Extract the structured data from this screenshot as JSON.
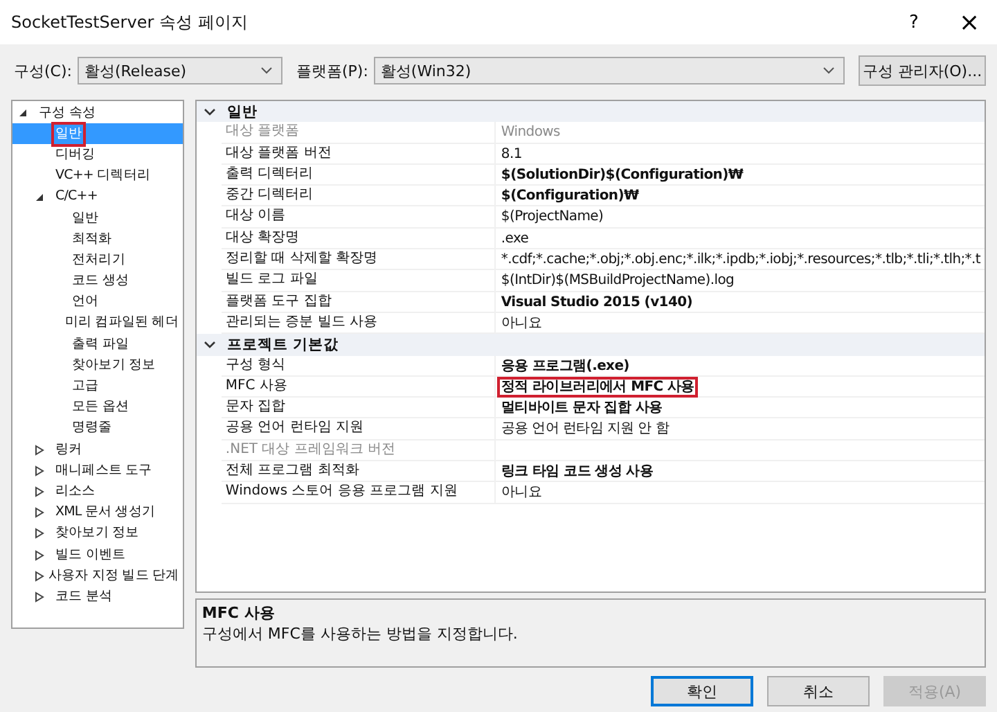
{
  "window": {
    "title": "SocketTestServer 속성 페이지",
    "help": "?",
    "close": "×"
  },
  "config_bar": {
    "configuration_label": "구성(C):",
    "configuration_value": "활성(Release)",
    "platform_label": "플랫폼(P):",
    "platform_value": "활성(Win32)",
    "manager_button": "구성 관리자(O)..."
  },
  "tree": {
    "items": [
      {
        "label": "구성 속성",
        "expanded": true,
        "selected": false,
        "annotated": false,
        "children": [
          {
            "label": "일반",
            "selected": true,
            "annotated": true
          },
          {
            "label": "디버깅",
            "selected": false,
            "annotated": false
          },
          {
            "label": "VC++ 디렉터리",
            "selected": false,
            "annotated": false
          },
          {
            "label": "C/C++",
            "expanded": true,
            "selected": false,
            "annotated": false,
            "children": [
              {
                "label": "일반",
                "selected": false,
                "annotated": false
              },
              {
                "label": "최적화",
                "selected": false,
                "annotated": false
              },
              {
                "label": "전처리기",
                "selected": false,
                "annotated": false
              },
              {
                "label": "코드 생성",
                "selected": false,
                "annotated": false
              },
              {
                "label": "언어",
                "selected": false,
                "annotated": false
              },
              {
                "label": "미리 컴파일된 헤더",
                "selected": false,
                "annotated": false
              },
              {
                "label": "출력 파일",
                "selected": false,
                "annotated": false
              },
              {
                "label": "찾아보기 정보",
                "selected": false,
                "annotated": false
              },
              {
                "label": "고급",
                "selected": false,
                "annotated": false
              },
              {
                "label": "모든 옵션",
                "selected": false,
                "annotated": false
              },
              {
                "label": "명령줄",
                "selected": false,
                "annotated": false
              }
            ]
          },
          {
            "label": "링커",
            "expanded": false,
            "selected": false,
            "annotated": false
          },
          {
            "label": "매니페스트 도구",
            "expanded": false,
            "selected": false,
            "annotated": false
          },
          {
            "label": "리소스",
            "expanded": false,
            "selected": false,
            "annotated": false
          },
          {
            "label": "XML 문서 생성기",
            "expanded": false,
            "selected": false,
            "annotated": false
          },
          {
            "label": "찾아보기 정보",
            "expanded": false,
            "selected": false,
            "annotated": false
          },
          {
            "label": "빌드 이벤트",
            "expanded": false,
            "selected": false,
            "annotated": false
          },
          {
            "label": "사용자 지정 빌드 단계",
            "expanded": false,
            "selected": false,
            "annotated": false
          },
          {
            "label": "코드 분석",
            "expanded": false,
            "selected": false,
            "annotated": false
          }
        ]
      }
    ]
  },
  "property_grid": {
    "sections": [
      {
        "title": "일반",
        "expanded": true,
        "rows": [
          {
            "label": "대상 플랫폼",
            "value": "Windows",
            "bold": false,
            "disabled": true,
            "annotated": false
          },
          {
            "label": "대상 플랫폼 버전",
            "value": "8.1",
            "bold": false,
            "disabled": false,
            "annotated": false
          },
          {
            "label": "출력 디렉터리",
            "value": "$(SolutionDir)$(Configuration)₩",
            "bold": true,
            "disabled": false,
            "annotated": false
          },
          {
            "label": "중간 디렉터리",
            "value": "$(Configuration)₩",
            "bold": true,
            "disabled": false,
            "annotated": false
          },
          {
            "label": "대상 이름",
            "value": "$(ProjectName)",
            "bold": false,
            "disabled": false,
            "annotated": false
          },
          {
            "label": "대상 확장명",
            "value": ".exe",
            "bold": false,
            "disabled": false,
            "annotated": false
          },
          {
            "label": "정리할 때 삭제할 확장명",
            "value": "*.cdf;*.cache;*.obj;*.obj.enc;*.ilk;*.ipdb;*.iobj;*.resources;*.tlb;*.tli;*.tlh;*.t",
            "bold": false,
            "disabled": false,
            "annotated": false
          },
          {
            "label": "빌드 로그 파일",
            "value": "$(IntDir)$(MSBuildProjectName).log",
            "bold": false,
            "disabled": false,
            "annotated": false
          },
          {
            "label": "플랫폼 도구 집합",
            "value": "Visual Studio 2015 (v140)",
            "bold": true,
            "disabled": false,
            "annotated": false
          },
          {
            "label": "관리되는 증분 빌드 사용",
            "value": "아니요",
            "bold": false,
            "disabled": false,
            "annotated": false
          }
        ]
      },
      {
        "title": "프로젝트 기본값",
        "expanded": true,
        "rows": [
          {
            "label": "구성 형식",
            "value": "응용 프로그램(.exe)",
            "bold": true,
            "disabled": false,
            "annotated": false
          },
          {
            "label": "MFC 사용",
            "value": "정적 라이브러리에서 MFC 사용",
            "bold": true,
            "disabled": false,
            "annotated": true
          },
          {
            "label": "문자 집합",
            "value": "멀티바이트 문자 집합 사용",
            "bold": true,
            "disabled": false,
            "annotated": false
          },
          {
            "label": "공용 언어 런타임 지원",
            "value": "공용 언어 런타임 지원 안 함",
            "bold": false,
            "disabled": false,
            "annotated": false
          },
          {
            "label": ".NET 대상 프레임워크 버전",
            "disabled": true
          },
          {
            "label": "전체 프로그램 최적화",
            "value": "링크 타임 코드 생성 사용",
            "bold": true,
            "disabled": false,
            "annotated": false
          },
          {
            "label": "Windows 스토어 응용 프로그램 지원",
            "value": "아니요",
            "bold": false,
            "disabled": false,
            "annotated": false
          }
        ]
      }
    ]
  },
  "description": {
    "title": "MFC 사용",
    "text": "구성에서 MFC를 사용하는 방법을 지정합니다."
  },
  "buttons": [
    {
      "label": "확인",
      "default": true,
      "disabled": false
    },
    {
      "label": "취소",
      "default": false,
      "disabled": false
    },
    {
      "label": "적용(A)",
      "default": false,
      "disabled": true
    }
  ]
}
